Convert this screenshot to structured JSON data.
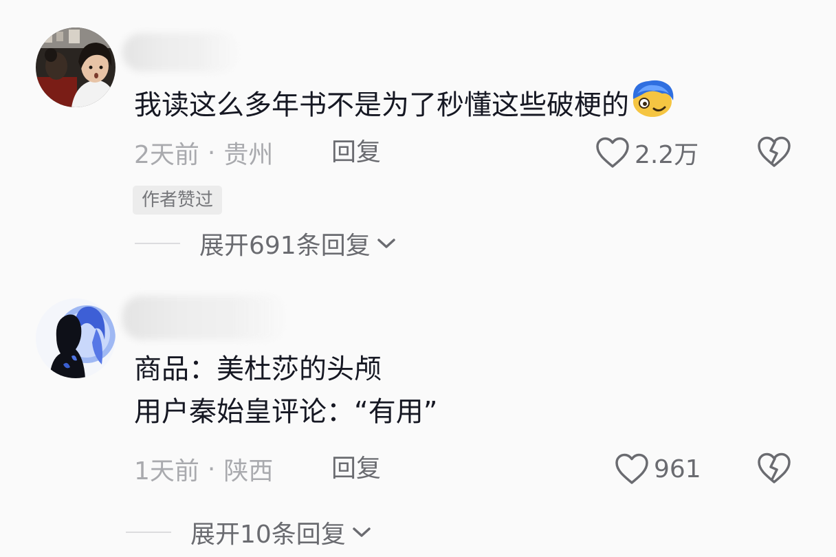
{
  "comments": [
    {
      "text": "我读这么多年书不是为了秒懂这些破梗的",
      "emoji_icon": "blue-hair-face-emoji",
      "time": "2天前",
      "separator": "·",
      "location": "贵州",
      "reply_label": "回复",
      "like_count": "2.2万",
      "badge": "作者赞过",
      "expand_label": "展开691条回复"
    },
    {
      "text_line1": "商品：美杜莎的头颅",
      "text_line2": "用户秦始皇评论：“有用”",
      "time": "1天前",
      "separator": "·",
      "location": "陕西",
      "reply_label": "回复",
      "like_count": "961",
      "expand_label": "展开10条回复"
    }
  ],
  "icons": {
    "like": "heart-outline-icon",
    "dislike": "broken-heart-icon",
    "expand": "chevron-down-icon"
  }
}
